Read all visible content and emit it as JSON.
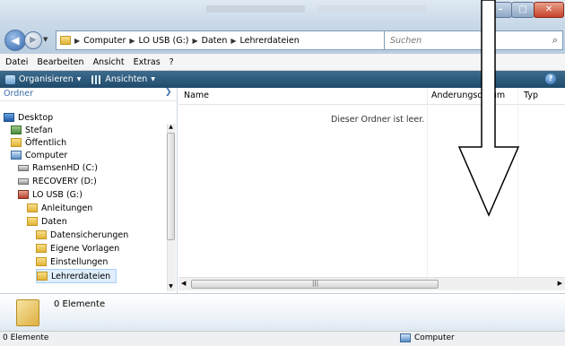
{
  "address_bar": {
    "breadcrumbs": [
      "Computer",
      "LO USB (G:)",
      "Daten",
      "Lehrerdateien"
    ],
    "search_placeholder": "Suchen"
  },
  "menu": {
    "items": [
      "Datei",
      "Bearbeiten",
      "Ansicht",
      "Extras",
      "?"
    ]
  },
  "toolbar": {
    "organize_label": "Organisieren",
    "views_label": "Ansichten"
  },
  "navpane": {
    "header": "Ordner",
    "items": [
      {
        "label": "Desktop",
        "icon": "desktop-icon"
      },
      {
        "label": "Stefan",
        "icon": "user-folder-icon"
      },
      {
        "label": "Öffentlich",
        "icon": "folder-icon"
      },
      {
        "label": "Computer",
        "icon": "computer-icon"
      },
      {
        "label": "RamsenHD (C:)",
        "icon": "drive-icon"
      },
      {
        "label": "RECOVERY (D:)",
        "icon": "drive-icon"
      },
      {
        "label": "LO USB (G:)",
        "icon": "usb-drive-icon"
      },
      {
        "label": "Anleitungen",
        "icon": "folder-icon"
      },
      {
        "label": "Daten",
        "icon": "folder-icon"
      },
      {
        "label": "Datensicherungen",
        "icon": "folder-icon"
      },
      {
        "label": "Eigene Vorlagen",
        "icon": "folder-icon"
      },
      {
        "label": "Einstellungen",
        "icon": "folder-icon"
      },
      {
        "label": "Lehrerdateien",
        "icon": "folder-icon",
        "selected": true
      }
    ]
  },
  "filelist": {
    "columns": [
      "Name",
      "Änderungsdatum",
      "Typ"
    ],
    "empty_message": "Dieser Ordner ist leer."
  },
  "details": {
    "count_text": "0 Elemente"
  },
  "statusbar": {
    "count_text": "0 Elemente",
    "location": "Computer"
  },
  "colors": {
    "toolbar": "#2b5678",
    "selection": "#dfeefc",
    "link_blue": "#3a6ea8"
  }
}
